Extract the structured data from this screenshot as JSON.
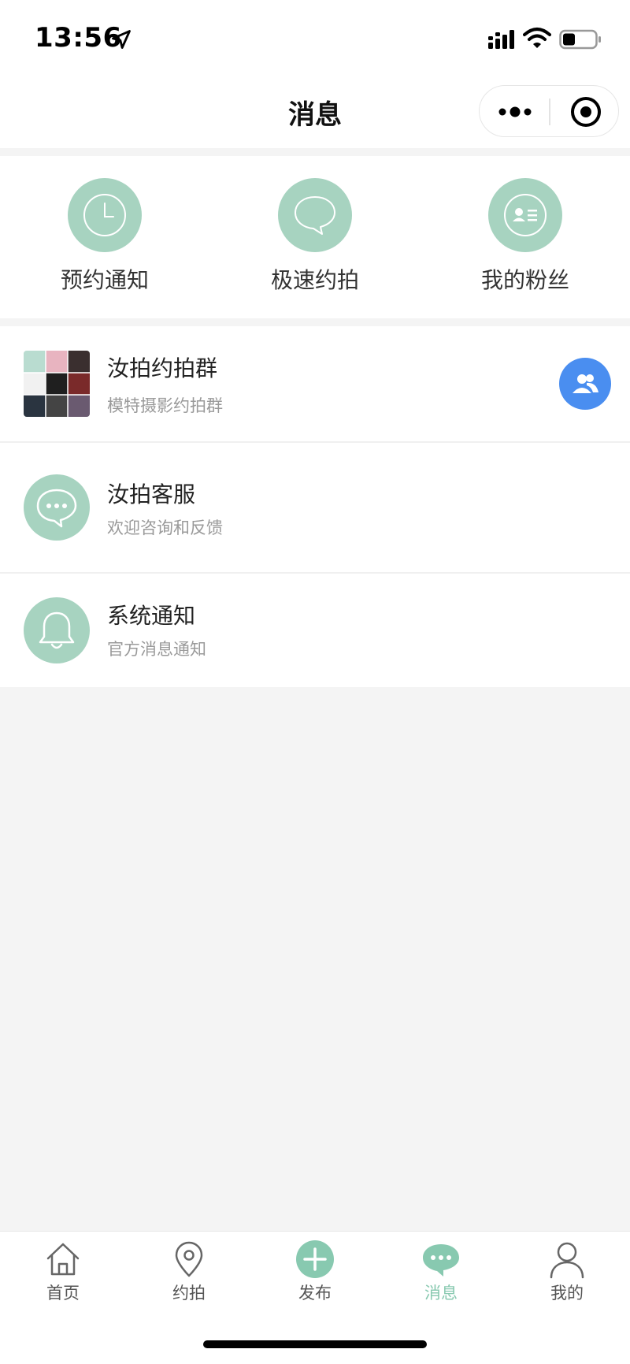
{
  "status_bar": {
    "time": "13:56"
  },
  "nav": {
    "title": "消息"
  },
  "shortcuts": [
    {
      "label": "预约通知",
      "icon": "clock-icon"
    },
    {
      "label": "极速约拍",
      "icon": "chat-bubble-icon"
    },
    {
      "label": "我的粉丝",
      "icon": "id-card-icon"
    }
  ],
  "messages": [
    {
      "title": "汝拍约拍群",
      "subtitle": "模特摄影约拍群",
      "avatar": "group-photo-collage"
    },
    {
      "title": "汝拍客服",
      "subtitle": "欢迎咨询和反馈",
      "avatar": "chat-dots-icon"
    },
    {
      "title": "系统通知",
      "subtitle": "官方消息通知",
      "avatar": "bell-icon"
    }
  ],
  "tabs": [
    {
      "label": "首页",
      "icon": "home-icon"
    },
    {
      "label": "约拍",
      "icon": "location-pin-icon"
    },
    {
      "label": "发布",
      "icon": "plus-circle-icon"
    },
    {
      "label": "消息",
      "icon": "message-icon",
      "active": true
    },
    {
      "label": "我的",
      "icon": "user-icon"
    }
  ],
  "colors": {
    "accent": "#a7d3c0",
    "active_tab": "#88c9b0",
    "group_badge": "#4a8ef0",
    "background": "#f4f4f4"
  }
}
